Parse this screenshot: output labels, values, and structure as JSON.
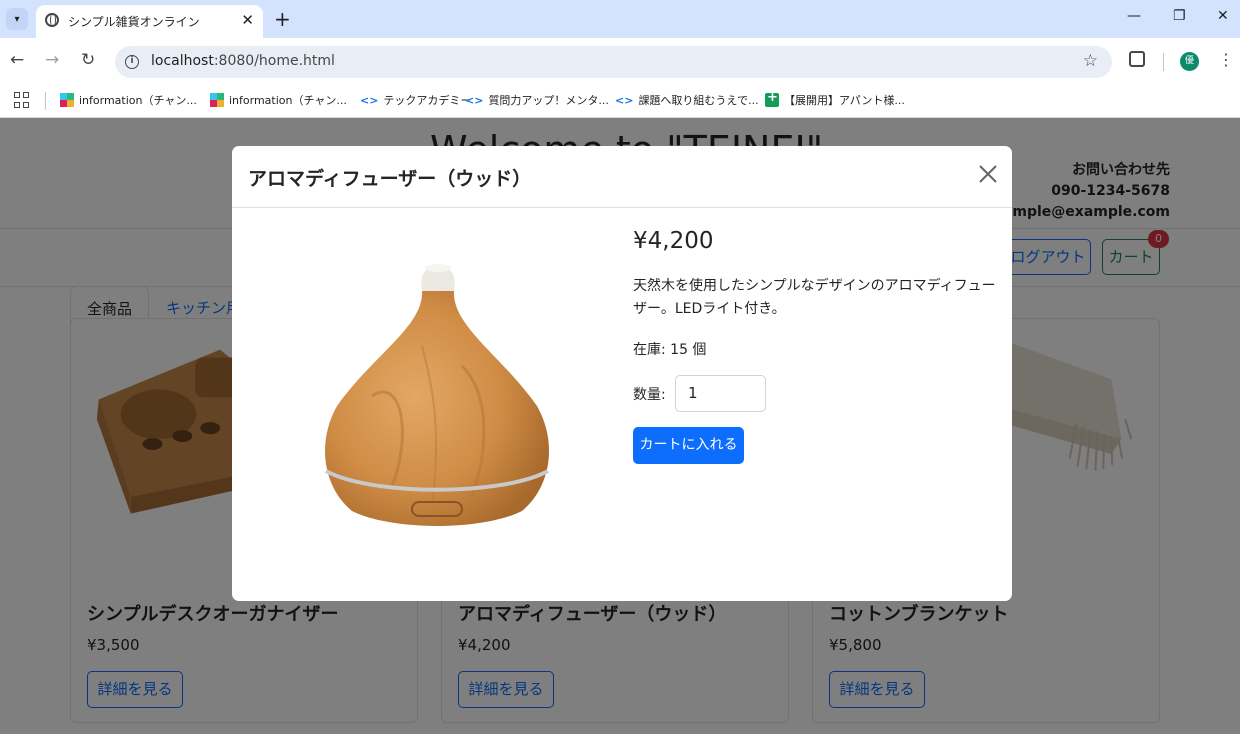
{
  "browser": {
    "tab_title": "シンプル雑貨オンライン",
    "url_host": "localhost",
    "url_path": ":8080/home.html",
    "profile_initial": "優",
    "bookmarks": [
      {
        "label": "information（チャン...",
        "icon": "slack-icon"
      },
      {
        "label": "information（チャン...",
        "icon": "slack-icon"
      },
      {
        "label": "テックアカデミー",
        "icon": "code-icon"
      },
      {
        "label": "質問力アップ！メンタ...",
        "icon": "code-icon"
      },
      {
        "label": "課題へ取り組むうえで...",
        "icon": "code-icon"
      },
      {
        "label": "【展開用】アパント様...",
        "icon": "sheets-icon"
      }
    ]
  },
  "site": {
    "title": "Welcome to \"TEINEI\"",
    "contact_heading": "お問い合わせ先",
    "contact_phone": "090-1234-5678",
    "contact_email": "sample@example.com",
    "logout_label": "ログアウト",
    "cart_label": "カート",
    "cart_count": "0",
    "categories": [
      "全商品",
      "キッチン用品"
    ]
  },
  "products": [
    {
      "name": "シンプルデスクオーガナイザー",
      "price": "¥3,500",
      "button": "詳細を見る"
    },
    {
      "name": "アロマディフューザー（ウッド）",
      "price": "¥4,200",
      "button": "詳細を見る"
    },
    {
      "name": "コットンブランケット",
      "price": "¥5,800",
      "button": "詳細を見る"
    }
  ],
  "modal": {
    "title": "アロマディフューザー（ウッド）",
    "price": "¥4,200",
    "description": "天然木を使用したシンプルなデザインのアロマディフューザー。LEDライト付き。",
    "stock": "在庫: 15 個",
    "quantity_label": "数量:",
    "quantity_value": "1",
    "add_to_cart": "カートに入れる"
  }
}
